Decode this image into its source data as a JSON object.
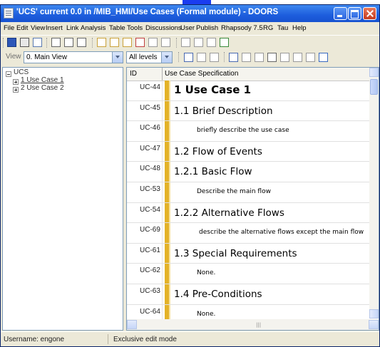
{
  "window": {
    "title": "'UCS' current 0.0 in /MIB_HMI/Use Cases (Formal module) - DOORS"
  },
  "menu": [
    "File",
    "Edit",
    "View",
    "Insert",
    "Link",
    "Analysis",
    "Table",
    "Tools",
    "Discussions",
    "User",
    "Publish",
    "Rhapsody 7.5",
    "RG",
    "Tau",
    "Help"
  ],
  "viewbar": {
    "view_label": "View",
    "view_value": "0. Main View",
    "levels_value": "All levels"
  },
  "tree": {
    "root": "UCS",
    "children": [
      "1 Use Case 1",
      "2 Use Case 2"
    ]
  },
  "table": {
    "columns": [
      "ID",
      "Use Case Specification"
    ],
    "rows": [
      {
        "id": "UC-44",
        "text": "1 Use Case 1",
        "style": "h1"
      },
      {
        "id": "UC-45",
        "text": "1.1 Brief Description",
        "style": "h2"
      },
      {
        "id": "UC-46",
        "text": "briefly describe the use case",
        "style": "b"
      },
      {
        "id": "UC-47",
        "text": "1.2 Flow of Events",
        "style": "h2"
      },
      {
        "id": "UC-48",
        "text": "1.2.1 Basic Flow",
        "style": "h3"
      },
      {
        "id": "UC-53",
        "text": "Describe the main flow",
        "style": "b"
      },
      {
        "id": "UC-54",
        "text": "1.2.2 Alternative Flows",
        "style": "h3"
      },
      {
        "id": "UC-69",
        "text": "describe the alternative flows except the main flow",
        "style": "b"
      },
      {
        "id": "UC-61",
        "text": "1.3 Special Requirements",
        "style": "h2"
      },
      {
        "id": "UC-62",
        "text": "None.",
        "style": "b"
      },
      {
        "id": "UC-63",
        "text": "1.4 Pre-Conditions",
        "style": "h2"
      },
      {
        "id": "UC-64",
        "text": "None.",
        "style": "b"
      }
    ]
  },
  "status": {
    "user": "Username: engone",
    "mode": "Exclusive edit mode"
  },
  "colors": {
    "titlebar": "#1d5ddd",
    "row_marker": "#e3b228",
    "chrome": "#ece9d8"
  }
}
